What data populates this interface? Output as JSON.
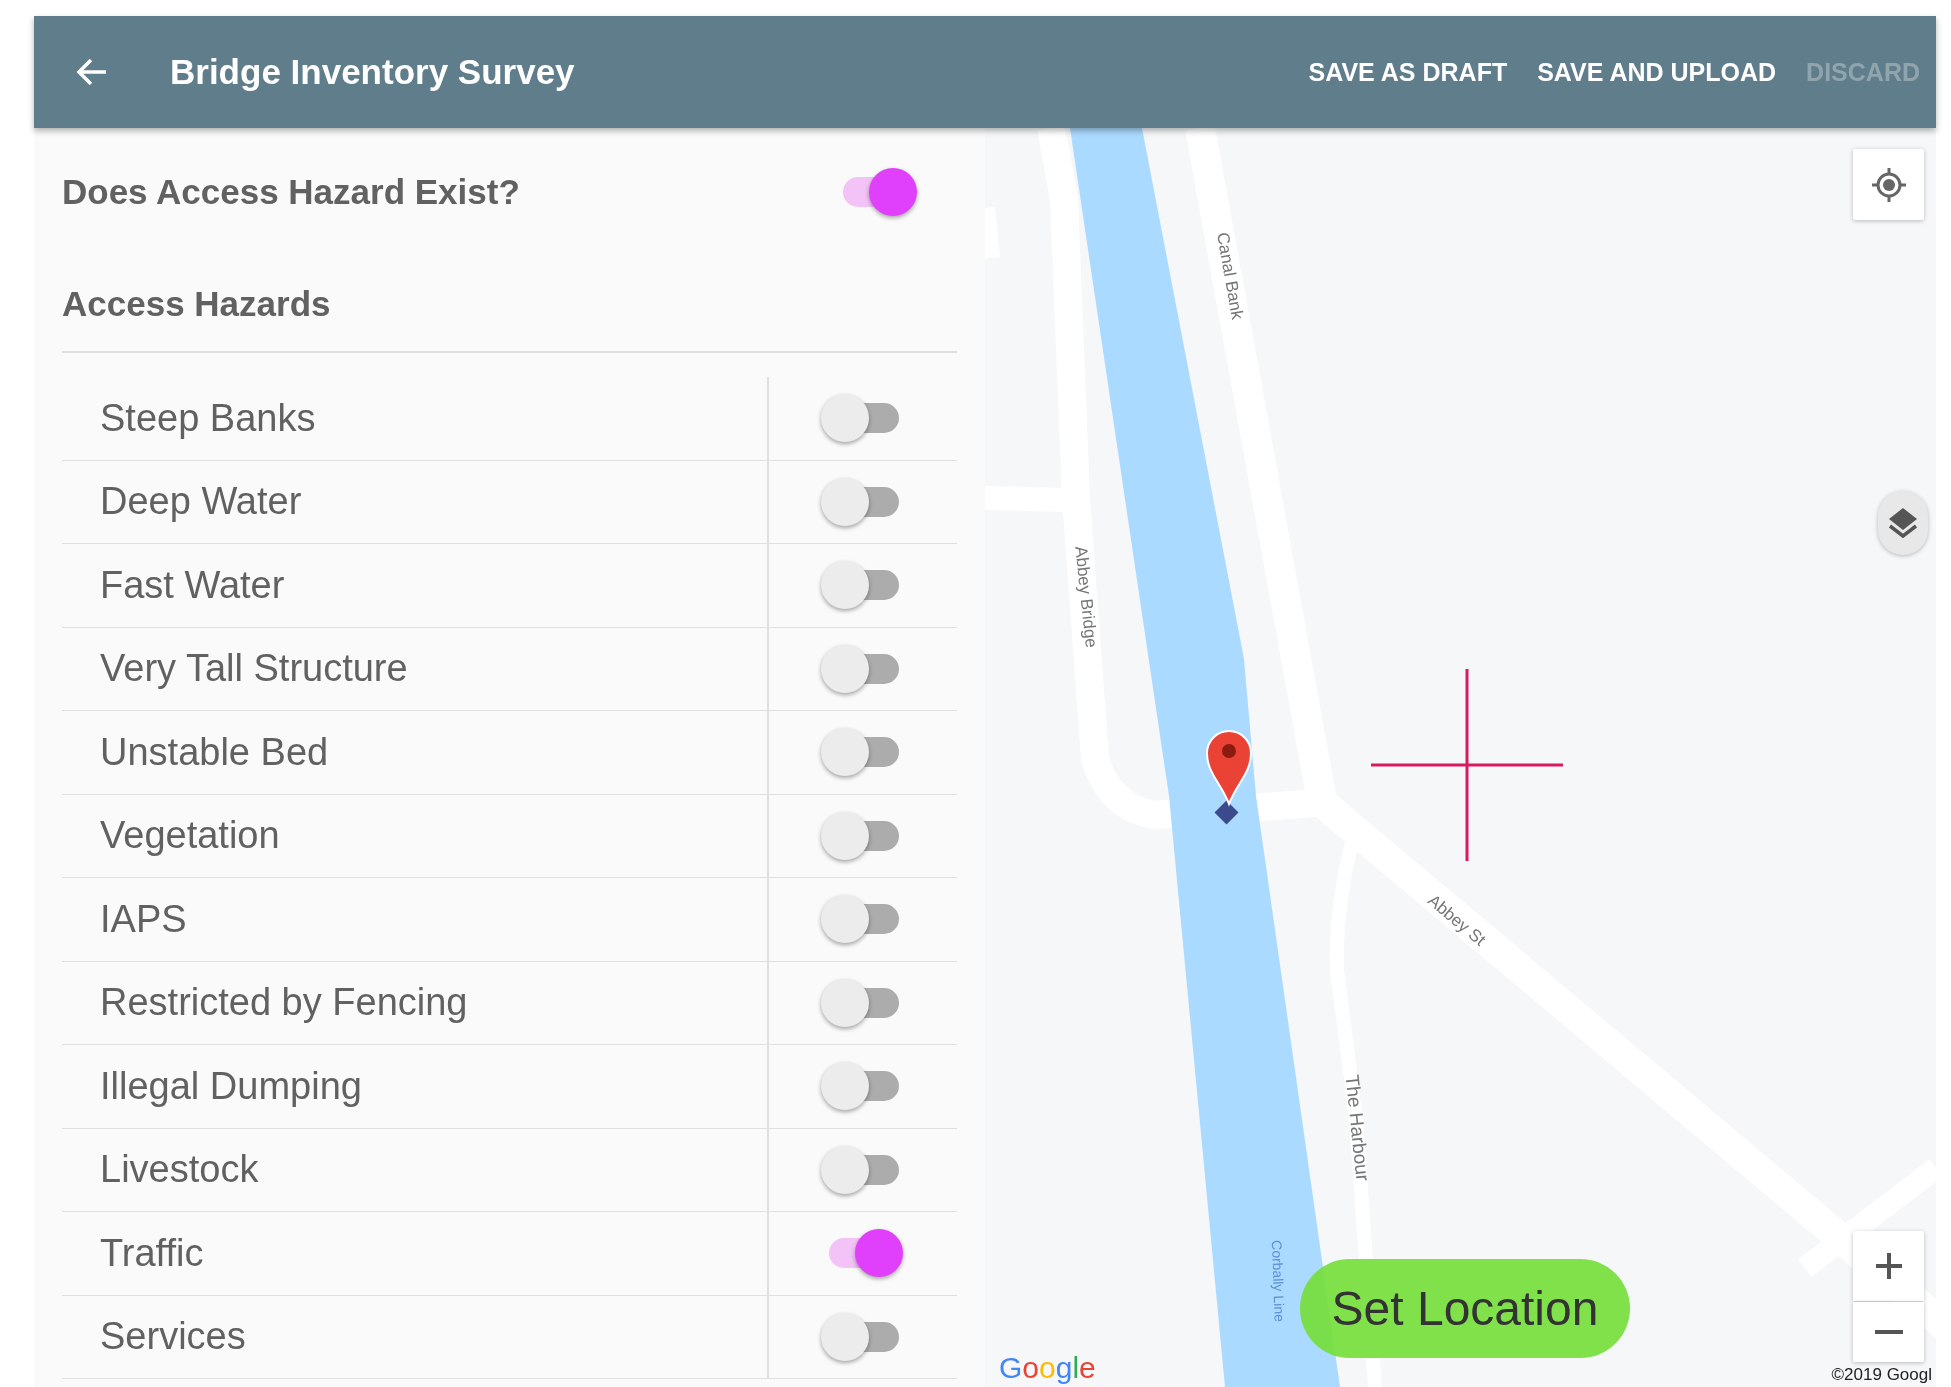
{
  "app_bar": {
    "title": "Bridge Inventory Survey",
    "actions": [
      {
        "label": "SAVE AS DRAFT",
        "disabled": false
      },
      {
        "label": "SAVE AND UPLOAD",
        "disabled": false
      },
      {
        "label": "DISCARD",
        "disabled": true
      }
    ]
  },
  "form": {
    "hazard_question": {
      "label": "Does Access Hazard Exist?",
      "on": true
    },
    "section_title": "Access Hazards",
    "hazards": [
      {
        "label": "Steep Banks",
        "on": false
      },
      {
        "label": "Deep Water",
        "on": false
      },
      {
        "label": "Fast Water",
        "on": false
      },
      {
        "label": "Very Tall Structure",
        "on": false
      },
      {
        "label": "Unstable Bed",
        "on": false
      },
      {
        "label": "Vegetation",
        "on": false
      },
      {
        "label": "IAPS",
        "on": false
      },
      {
        "label": "Restricted by Fencing",
        "on": false
      },
      {
        "label": "Illegal Dumping",
        "on": false
      },
      {
        "label": "Livestock",
        "on": false
      },
      {
        "label": "Traffic",
        "on": true
      },
      {
        "label": "Services",
        "on": false
      }
    ]
  },
  "map": {
    "labels": [
      {
        "text": "Canal Bank",
        "kind": "street"
      },
      {
        "text": "Abbey Bridge",
        "kind": "street"
      },
      {
        "text": "Abbey St",
        "kind": "street"
      },
      {
        "text": "The Harbour",
        "kind": "street"
      },
      {
        "text": "Corbally Line",
        "kind": "water"
      }
    ],
    "logo": "Google",
    "attribution": "©2019 Googl",
    "set_location_button": "Set Location"
  }
}
